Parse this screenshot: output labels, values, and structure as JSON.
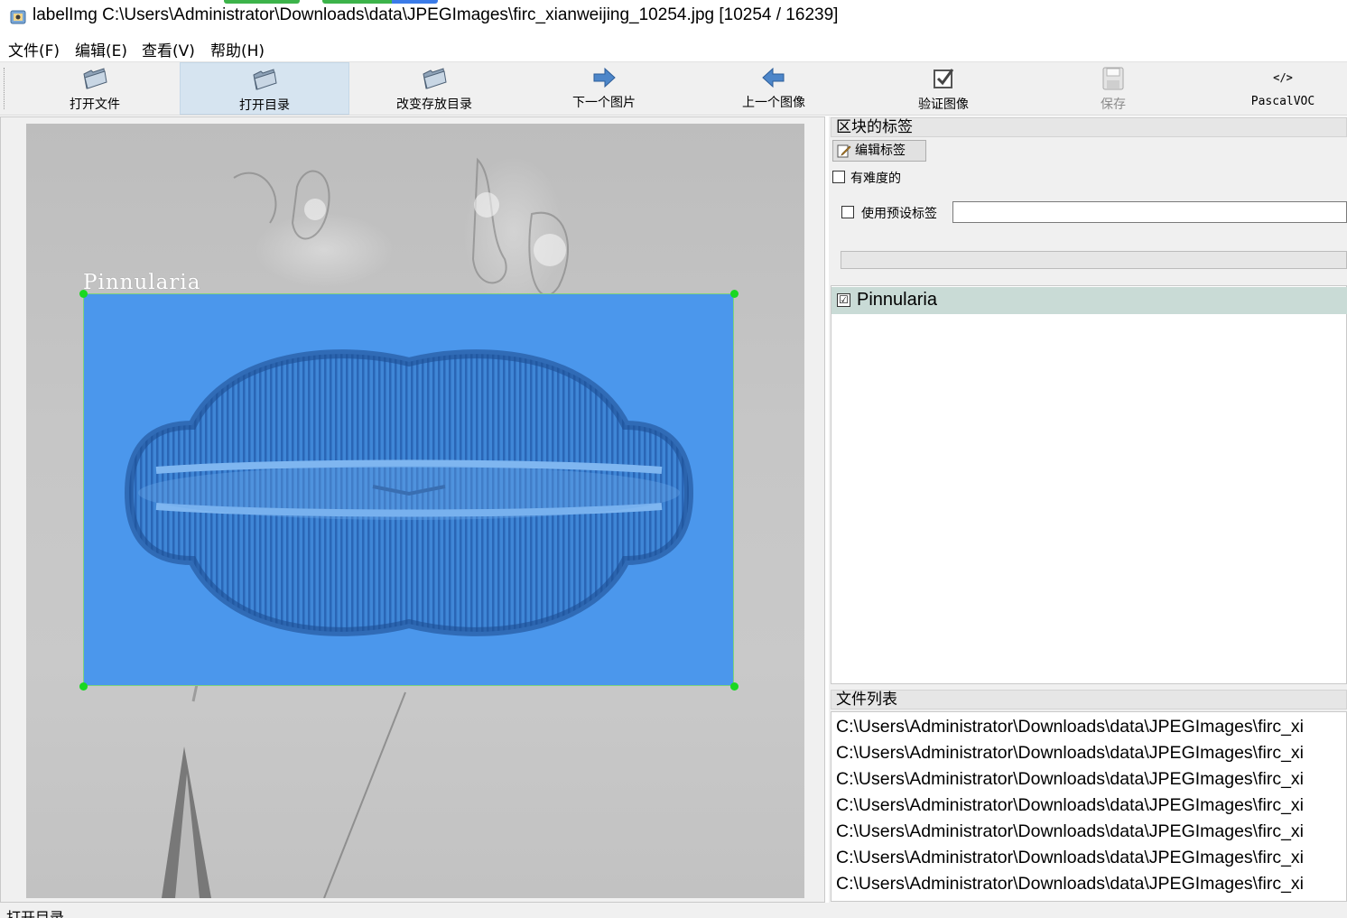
{
  "window": {
    "title": "labelImg C:\\Users\\Administrator\\Downloads\\data\\JPEGImages\\firc_xianweijing_10254.jpg [10254 / 16239]"
  },
  "menu": [
    {
      "label": "文件(F)"
    },
    {
      "label": "编辑(E)"
    },
    {
      "label": "查看(V)"
    },
    {
      "label": "帮助(H)"
    }
  ],
  "toolbar": {
    "open_file": "打开文件",
    "open_dir": "打开目录",
    "change_save_dir": "改变存放目录",
    "next_image": "下一个图片",
    "prev_image": "上一个图像",
    "verify_image": "验证图像",
    "save": "保存",
    "format": "PascalVOC",
    "active_tool": "open_dir",
    "save_enabled": false
  },
  "canvas": {
    "box_label": "Pinnularia",
    "box_fill_color": "#4b97ec",
    "handle_color": "#19d822"
  },
  "box_labels_panel": {
    "title": "区块的标签",
    "edit_label_button": "编辑标签",
    "difficult_label": "有难度的",
    "difficult_checked": false,
    "use_default_label": "使用预设标签",
    "use_default_checked": false,
    "default_label_value": "",
    "labels": [
      {
        "text": "Pinnularia",
        "checked": true,
        "check_glyph": "☑"
      }
    ]
  },
  "file_list_panel": {
    "title": "文件列表",
    "files": [
      "C:\\Users\\Administrator\\Downloads\\data\\JPEGImages\\firc_xi",
      "C:\\Users\\Administrator\\Downloads\\data\\JPEGImages\\firc_xi",
      "C:\\Users\\Administrator\\Downloads\\data\\JPEGImages\\firc_xi",
      "C:\\Users\\Administrator\\Downloads\\data\\JPEGImages\\firc_xi",
      "C:\\Users\\Administrator\\Downloads\\data\\JPEGImages\\firc_xi",
      "C:\\Users\\Administrator\\Downloads\\data\\JPEGImages\\firc_xi",
      "C:\\Users\\Administrator\\Downloads\\data\\JPEGImages\\firc_xi"
    ]
  },
  "status": {
    "text": "打开目录"
  }
}
